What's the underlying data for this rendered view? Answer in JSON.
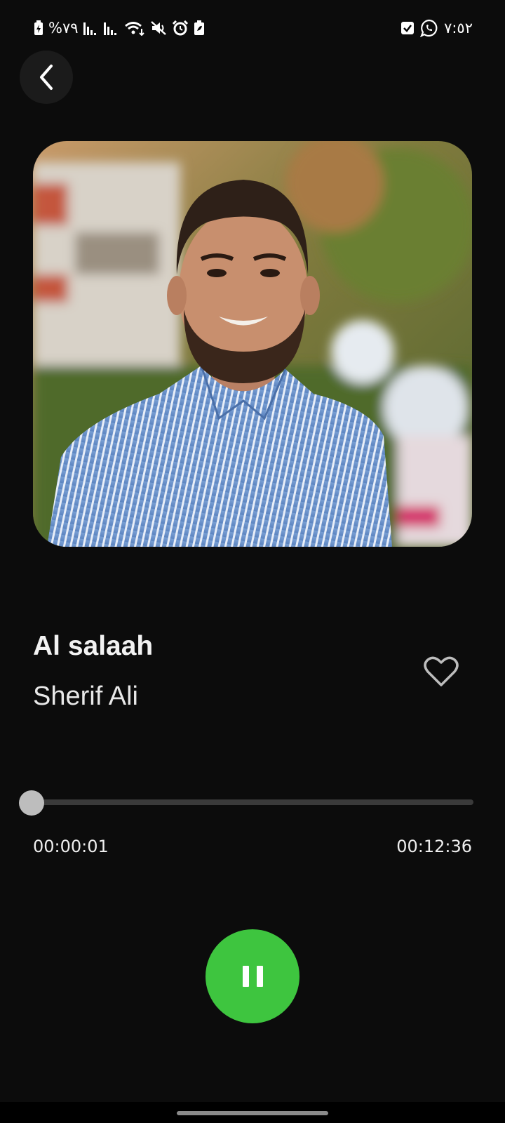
{
  "status_bar": {
    "battery_percent": "%٧٩",
    "time": "٧:٥٢",
    "left_icons": [
      "battery-charging-icon",
      "signal-icon",
      "signal-icon",
      "wifi-icon",
      "mute-icon",
      "alarm-icon",
      "battery-saver-icon"
    ],
    "right_icons": [
      "checkbox-icon",
      "whatsapp-icon"
    ]
  },
  "player": {
    "artwork_icon": "artist-photo",
    "track_title": "Al salaah",
    "artist_name": "Sherif Ali",
    "favorite_icon": "heart-outline-icon",
    "progress_fraction": 0.0013,
    "time_current": "00:00:01",
    "time_total": "00:12:36",
    "play_state_icon": "pause-icon"
  },
  "colors": {
    "background": "#0c0c0c",
    "accent": "#3ec53f",
    "progress_track": "#3a3a3a",
    "progress_thumb": "#bdbdbd"
  }
}
